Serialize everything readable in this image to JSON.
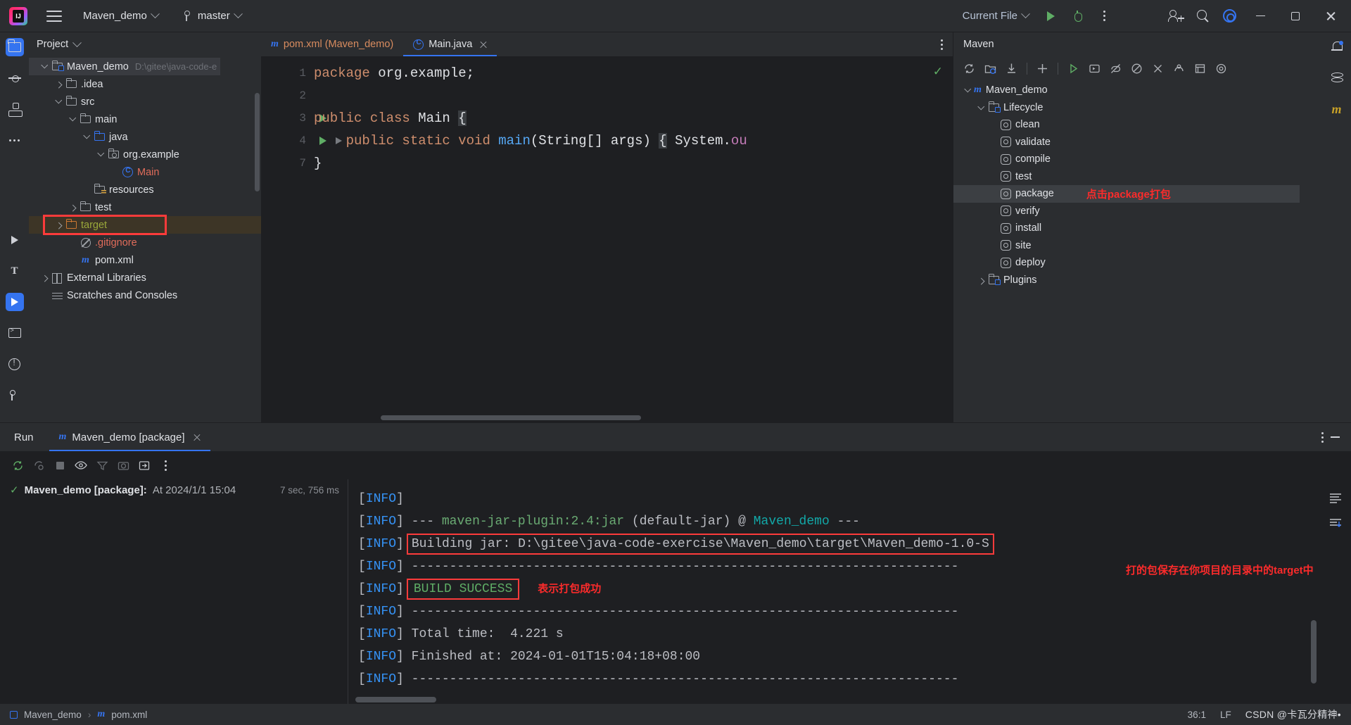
{
  "titlebar": {
    "project_name": "Maven_demo",
    "branch": "master",
    "run_config": "Current File",
    "icons": [
      "intellij-logo",
      "hamburger-menu",
      "branch-icon",
      "run-button",
      "debug-button",
      "more-options",
      "add-user-icon",
      "search-icon",
      "settings-gear",
      "minimize",
      "maximize",
      "close"
    ]
  },
  "project_panel": {
    "title": "Project",
    "tree": [
      {
        "label": "Maven_demo",
        "path": "D:\\gitee\\java-code-e",
        "indent": 0,
        "arrow": "down",
        "icon": "module-folder-icon",
        "selected": true
      },
      {
        "label": ".idea",
        "path": "",
        "indent": 1,
        "arrow": "right",
        "icon": "folder-icon"
      },
      {
        "label": "src",
        "path": "",
        "indent": 1,
        "arrow": "down",
        "icon": "folder-icon"
      },
      {
        "label": "main",
        "path": "",
        "indent": 2,
        "arrow": "down",
        "icon": "folder-icon"
      },
      {
        "label": "java",
        "path": "",
        "indent": 3,
        "arrow": "down",
        "icon": "source-folder-icon"
      },
      {
        "label": "org.example",
        "path": "",
        "indent": 4,
        "arrow": "down",
        "icon": "package-icon"
      },
      {
        "label": "Main",
        "path": "",
        "indent": 5,
        "arrow": "",
        "icon": "java-class-icon",
        "color": "red"
      },
      {
        "label": "resources",
        "path": "",
        "indent": 3,
        "arrow": "",
        "icon": "resources-folder-icon"
      },
      {
        "label": "test",
        "path": "",
        "indent": 2,
        "arrow": "right",
        "icon": "folder-icon"
      },
      {
        "label": "target",
        "path": "",
        "indent": 1,
        "arrow": "right",
        "icon": "target-folder-icon",
        "color": "green",
        "highlighted": true
      },
      {
        "label": ".gitignore",
        "path": "",
        "indent": 2,
        "arrow": "",
        "icon": "gitignore-icon",
        "color": "red"
      },
      {
        "label": "pom.xml",
        "path": "",
        "indent": 2,
        "arrow": "",
        "icon": "maven-pom-icon"
      },
      {
        "label": "External Libraries",
        "path": "",
        "indent": 0,
        "arrow": "right",
        "icon": "libraries-icon"
      },
      {
        "label": "Scratches and Consoles",
        "path": "",
        "indent": 0,
        "arrow": "",
        "icon": "scratches-icon"
      }
    ]
  },
  "editor": {
    "tabs": [
      {
        "label": "pom.xml (Maven_demo)",
        "icon": "maven-pom-icon",
        "active": false,
        "closable": false
      },
      {
        "label": "Main.java",
        "icon": "java-class-icon",
        "active": true,
        "closable": true
      }
    ],
    "line_numbers": [
      "1",
      "2",
      "3",
      "4",
      "7"
    ],
    "code_lines": [
      {
        "num": "1",
        "text": "package org.example;"
      },
      {
        "num": "2",
        "text": ""
      },
      {
        "num": "3",
        "text": "public class Main {"
      },
      {
        "num": "4",
        "text": "    public static void main(String[] args) { System.ou"
      },
      {
        "num": "7",
        "text": "}"
      }
    ]
  },
  "maven_panel": {
    "title": "Maven",
    "toolbar_icons": [
      "reload-icon",
      "add-maven-project-icon",
      "download-sources-icon",
      "add-icon",
      "run-icon",
      "execute-goal-icon",
      "skip-tests-icon",
      "toggle-offline-icon",
      "collapse-icon",
      "expand-icon",
      "show-diagram-icon",
      "settings-icon"
    ],
    "tree": [
      {
        "label": "Maven_demo",
        "indent": 0,
        "arrow": "down",
        "icon": "maven-module-icon"
      },
      {
        "label": "Lifecycle",
        "indent": 1,
        "arrow": "down",
        "icon": "lifecycle-folder-icon"
      },
      {
        "label": "clean",
        "indent": 2,
        "arrow": "",
        "icon": "goal-icon"
      },
      {
        "label": "validate",
        "indent": 2,
        "arrow": "",
        "icon": "goal-icon"
      },
      {
        "label": "compile",
        "indent": 2,
        "arrow": "",
        "icon": "goal-icon"
      },
      {
        "label": "test",
        "indent": 2,
        "arrow": "",
        "icon": "goal-icon"
      },
      {
        "label": "package",
        "indent": 2,
        "arrow": "",
        "icon": "goal-icon",
        "selected": true,
        "annotation": "点击package打包"
      },
      {
        "label": "verify",
        "indent": 2,
        "arrow": "",
        "icon": "goal-icon"
      },
      {
        "label": "install",
        "indent": 2,
        "arrow": "",
        "icon": "goal-icon"
      },
      {
        "label": "site",
        "indent": 2,
        "arrow": "",
        "icon": "goal-icon"
      },
      {
        "label": "deploy",
        "indent": 2,
        "arrow": "",
        "icon": "goal-icon"
      },
      {
        "label": "Plugins",
        "indent": 1,
        "arrow": "right",
        "icon": "plugins-folder-icon"
      }
    ]
  },
  "run_panel": {
    "title": "Run",
    "tab_label": "Maven_demo [package]",
    "tab_icon": "maven-pom-icon",
    "toolbar_icons": [
      "rerun-icon",
      "rerun-failed-icon",
      "stop-icon",
      "eye-icon",
      "filter-icon",
      "camera-icon",
      "export-icon",
      "more-icon"
    ],
    "tree_item": {
      "name": "Maven_demo [package]:",
      "at": "At 2024/1/1 15:04",
      "duration": "7 sec, 756 ms",
      "status_icon": "check-icon"
    },
    "console_lines": [
      {
        "tag": "[INFO]",
        "body": "",
        "style": "plain"
      },
      {
        "tag": "[INFO]",
        "body": " --- maven-jar-plugin:2.4:jar (default-jar) @ Maven_demo ---",
        "style": "plugin"
      },
      {
        "tag": "[INFO]",
        "body": " Building jar: D:\\gitee\\java-code-exercise\\Maven_demo\\target\\Maven_demo-1.0-S",
        "style": "boxed"
      },
      {
        "tag": "[INFO]",
        "body": " ------------------------------------------------------------------------",
        "style": "plain"
      },
      {
        "tag": "[INFO]",
        "body": " BUILD SUCCESS",
        "style": "success-boxed"
      },
      {
        "tag": "[INFO]",
        "body": " ------------------------------------------------------------------------",
        "style": "plain"
      },
      {
        "tag": "[INFO]",
        "body": " Total time:  4.221 s",
        "style": "plain"
      },
      {
        "tag": "[INFO]",
        "body": " Finished at: 2024-01-01T15:04:18+08:00",
        "style": "plain"
      },
      {
        "tag": "[INFO]",
        "body": " ------------------------------------------------------------------------",
        "style": "plain"
      }
    ],
    "annotations": {
      "build_success": "表示打包成功",
      "jar_location": "打的包保存在你项目的目录中的target中"
    }
  },
  "statusbar": {
    "breadcrumb_project": "Maven_demo",
    "breadcrumb_file": "pom.xml",
    "caret": "36:1",
    "line_sep": "LF",
    "watermark": "CSDN @卡瓦分精神•"
  },
  "colors": {
    "accent_blue": "#3574f0",
    "annotation_red": "#fc2b2b",
    "success_green": "#5fad65",
    "highlight_box": "#fc3b3b"
  }
}
